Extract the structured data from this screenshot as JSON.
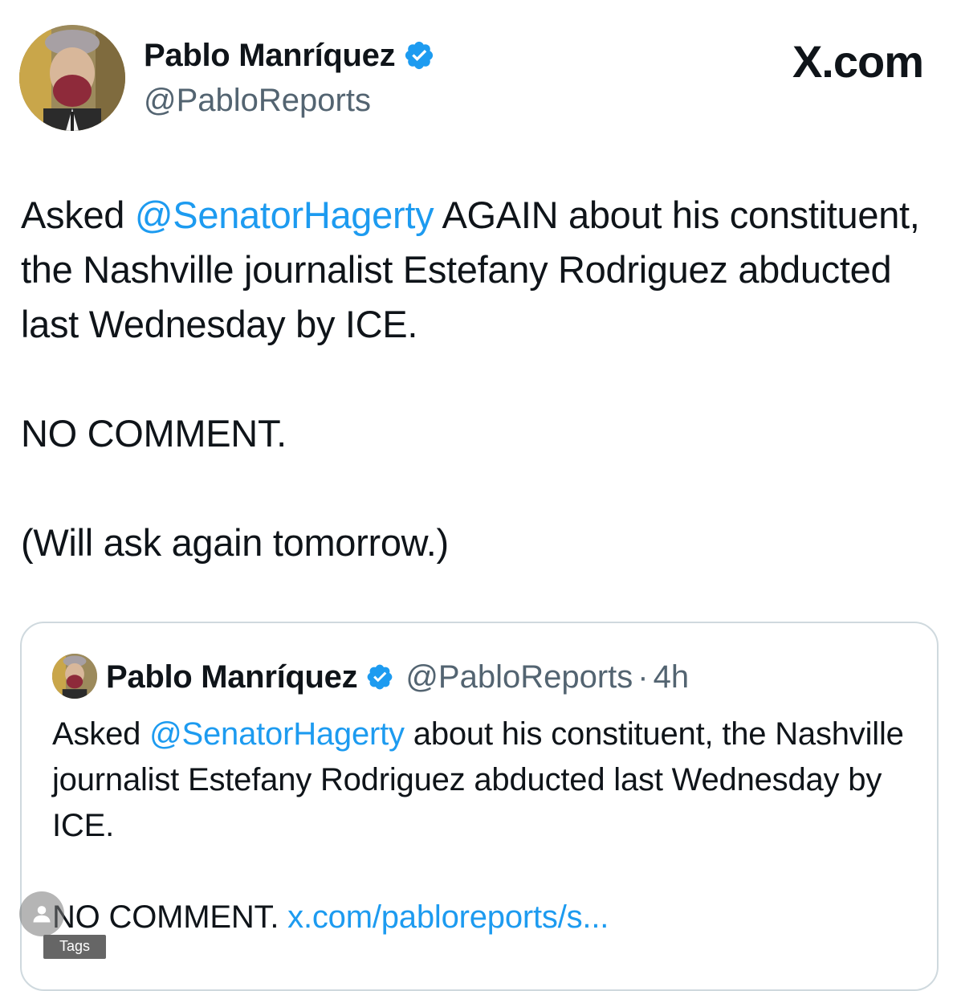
{
  "tweet": {
    "author_name": "Pablo Manríquez",
    "handle": "@PabloReports",
    "verified_icon": "verified-badge-icon",
    "brand": "X.com",
    "text": {
      "line1_before": "Asked ",
      "line1_mention": "@SenatorHagerty",
      "line1_after": " AGAIN about his constituent, the Nashville journalist Estefany Rodriguez abducted last Wednesday by ICE.",
      "para2": "NO COMMENT.",
      "para3": "(Will ask again tomorrow.)"
    }
  },
  "quoted_tweet": {
    "author_name": "Pablo Manríquez",
    "handle": "@PabloReports",
    "separator": "·",
    "time": "4h",
    "text": {
      "before": "Asked ",
      "mention": "@SenatorHagerty",
      "after": " about his constituent, the Nashville journalist Estefany Rodriguez abducted last Wednesday by ICE.",
      "para2_text": "NO COMMENT. ",
      "para2_link": "x.com/pabloreports/s..."
    }
  },
  "overlay": {
    "user_icon": "user-icon",
    "tags_label": "Tags"
  },
  "colors": {
    "link": "#1d9bf0",
    "secondary_text": "#536471",
    "border": "#cfd9de"
  }
}
